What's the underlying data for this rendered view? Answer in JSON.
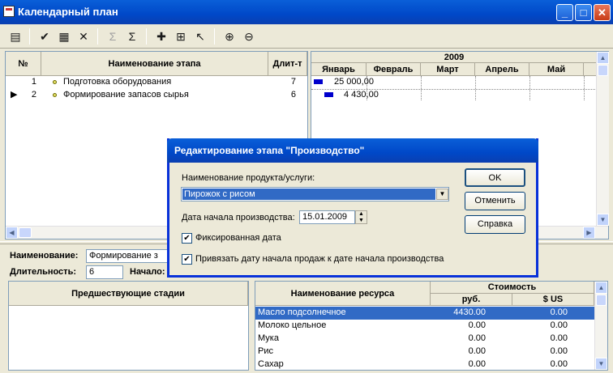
{
  "window": {
    "title": "Календарный план"
  },
  "toolbar": {
    "icons": [
      "edit-list-icon",
      "check-icon",
      "calculator-icon",
      "delete-icon",
      "sum-disabled-icon",
      "sum-icon",
      "add-icon",
      "hierarchy-icon",
      "pointer-icon",
      "zoom-in-icon",
      "zoom-out-icon"
    ]
  },
  "stages": {
    "headers": {
      "num": "№",
      "name": "Наименование этапа",
      "duration": "Длит-т"
    },
    "rows": [
      {
        "num": "1",
        "name": "Подготовка оборудования",
        "duration": "7"
      },
      {
        "num": "2",
        "name": "Формирование запасов сырья",
        "duration": "6"
      }
    ]
  },
  "gantt": {
    "year": "2009",
    "months": [
      "Январь",
      "Февраль",
      "Март",
      "Апрель",
      "Май"
    ],
    "bars": [
      {
        "label": "25 000,00"
      },
      {
        "label": "4 430,00"
      }
    ],
    "bar_color": "#0000cc"
  },
  "details": {
    "name_label": "Наименование:",
    "name_value": "Формирование з",
    "duration_label": "Длительность:",
    "duration_value": "6",
    "start_label": "Начало:",
    "predecessors_header": "Предшествующие стадии"
  },
  "resources": {
    "headers": {
      "name": "Наименование ресурса",
      "cost": "Стоимость",
      "rub": "руб.",
      "usd": "$ US"
    },
    "rows": [
      {
        "name": "Масло подсолнечное",
        "rub": "4430.00",
        "usd": "0.00"
      },
      {
        "name": "Молоко цельное",
        "rub": "0.00",
        "usd": "0.00"
      },
      {
        "name": "Мука",
        "rub": "0.00",
        "usd": "0.00"
      },
      {
        "name": "Рис",
        "rub": "0.00",
        "usd": "0.00"
      },
      {
        "name": "Сахар",
        "rub": "0.00",
        "usd": "0.00"
      }
    ]
  },
  "dialog": {
    "title": "Редактирование этапа \"Производство\"",
    "product_label": "Наименование продукта/услуги:",
    "product_value": "Пирожок с рисом",
    "date_label": "Дата начала производства:",
    "date_value": "15.01.2009",
    "fixed_date_label": "Фиксированная дата",
    "fixed_date_checked": true,
    "link_sales_label": "Привязать дату начала продаж к дате начала производства",
    "link_sales_checked": true,
    "ok_label": "OK",
    "cancel_label": "Отменить",
    "help_label": "Справка"
  }
}
